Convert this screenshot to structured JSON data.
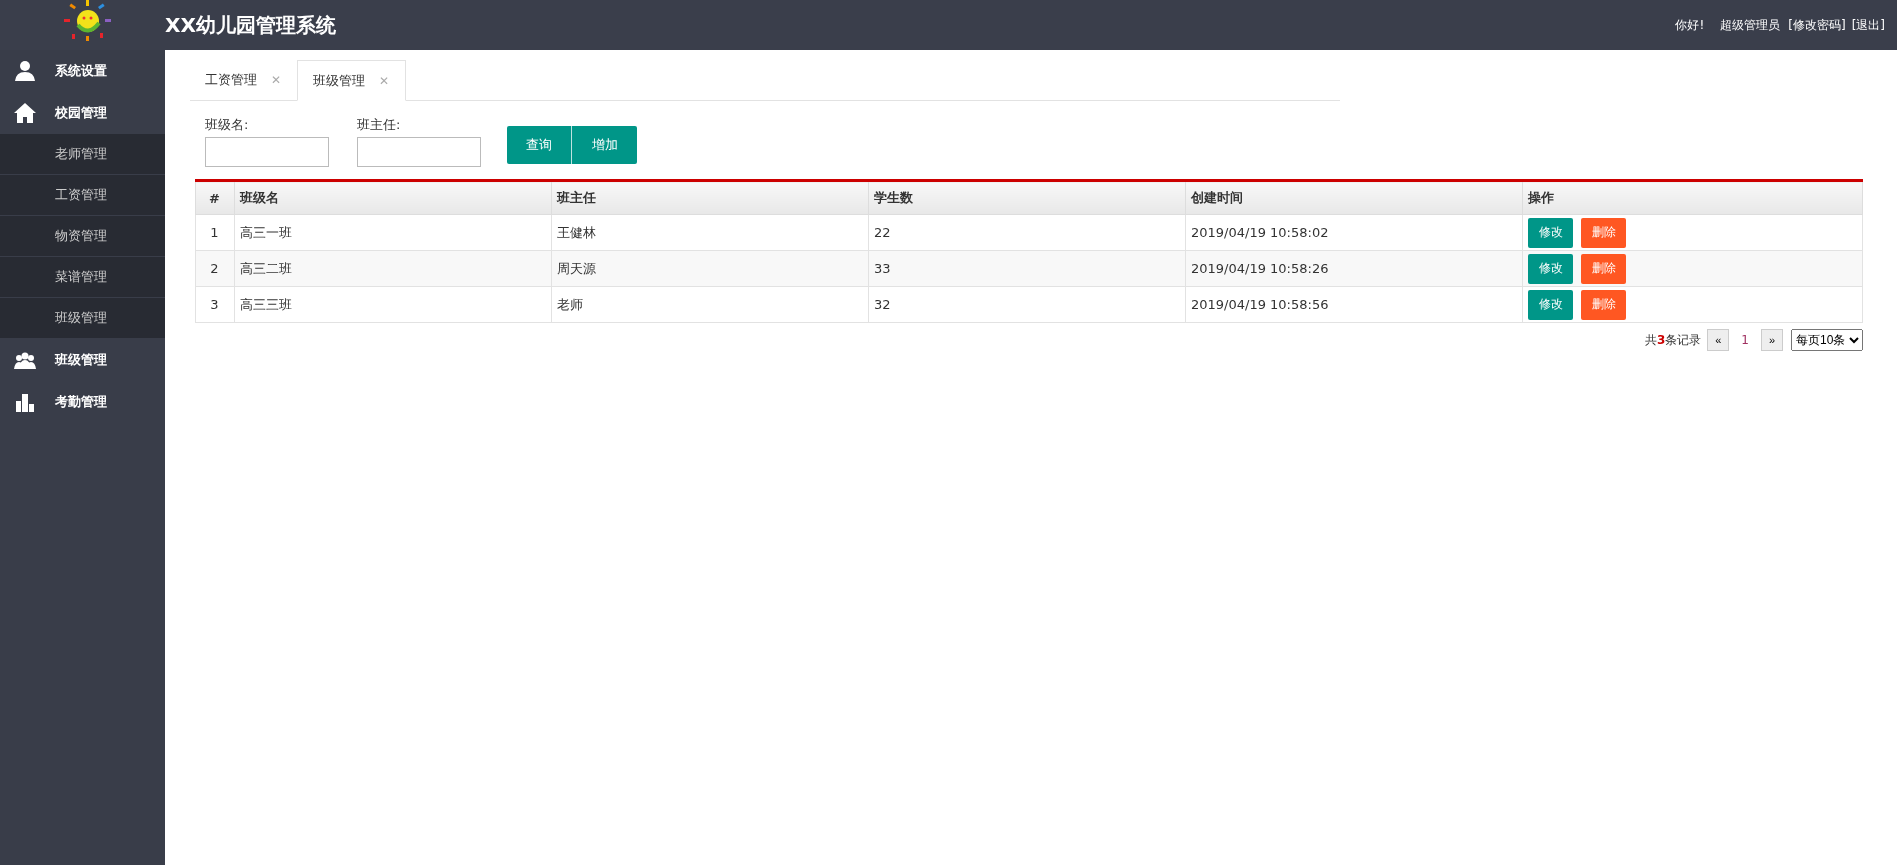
{
  "header": {
    "title": "XX幼儿园管理系统",
    "greeting": "你好!",
    "user": "超级管理员",
    "links": [
      "[修改密码]",
      "[退出]"
    ]
  },
  "sidebar": {
    "items": [
      {
        "label": "系统设置"
      },
      {
        "label": "校园管理",
        "expanded": true,
        "children": [
          {
            "label": "老师管理"
          },
          {
            "label": "工资管理"
          },
          {
            "label": "物资管理"
          },
          {
            "label": "菜谱管理"
          },
          {
            "label": "班级管理"
          }
        ]
      },
      {
        "label": "班级管理"
      },
      {
        "label": "考勤管理"
      }
    ]
  },
  "tabs": [
    {
      "label": "工资管理",
      "selected": false,
      "close": "✕"
    },
    {
      "label": "班级管理",
      "selected": true,
      "close": "✕"
    }
  ],
  "search": {
    "fields": [
      {
        "label": "班级名:"
      },
      {
        "label": "班主任:"
      }
    ],
    "buttons": [
      "查询",
      "增加"
    ]
  },
  "table": {
    "columns": [
      "#",
      "班级名",
      "班主任",
      "学生数",
      "创建时间",
      "操作"
    ],
    "rows": [
      {
        "cells": [
          "1",
          "高三一班",
          "王健林",
          "22",
          "2019/04/19 10:58:02"
        ],
        "actions": [
          "修改",
          "删除"
        ]
      },
      {
        "cells": [
          "2",
          "高三二班",
          "周天源",
          "33",
          "2019/04/19 10:58:26"
        ],
        "actions": [
          "修改",
          "删除"
        ]
      },
      {
        "cells": [
          "3",
          "高三三班",
          "老师",
          "32",
          "2019/04/19 10:58:56"
        ],
        "actions": [
          "修改",
          "删除"
        ]
      }
    ]
  },
  "pagination": {
    "total_prefix": "共",
    "total_count": "3",
    "total_suffix": "条记录",
    "prev": "«",
    "pages": [
      {
        "label": "1",
        "selected": true
      }
    ],
    "next": "»",
    "page_size": "每页10条"
  }
}
